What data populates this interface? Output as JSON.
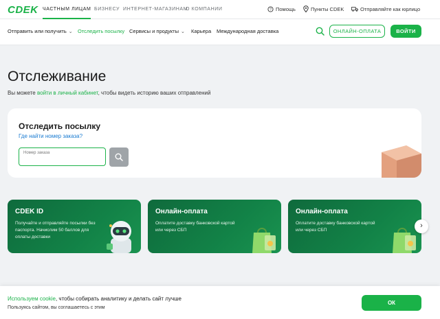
{
  "brand": {
    "logo": "CDEK",
    "accent": "#1ab248"
  },
  "top_segments": [
    "ЧАСТНЫМ ЛИЦАМ",
    "БИЗНЕСУ",
    "ИНТЕРНЕТ-МАГАЗИНАМ",
    "О КОМПАНИИ"
  ],
  "top_utils": {
    "help": "Помощь",
    "points": "Пункты CDEK",
    "send_as_company": "Отправляйте как юрлицо"
  },
  "nav": {
    "items": [
      "Отправить или получить",
      "Отследить посылку",
      "Сервисы и продукты",
      "Карьера",
      "Международная доставка"
    ],
    "online_payment": "ОНЛАЙН-ОПЛАТА",
    "login": "ВОЙТИ"
  },
  "main": {
    "title": "Отслеживание",
    "subtitle_before": "Вы можете ",
    "subtitle_link": "войти в личный кабинет",
    "subtitle_after": ", чтобы видеть историю ваших отправлений"
  },
  "tracking": {
    "title": "Отследить посылку",
    "help_link": "Где найти номер заказа?",
    "order_placeholder": "Номер заказа"
  },
  "promos": [
    {
      "title": "CDEK ID",
      "text": "Получайте и отправляйте посылки без паспорта. Начислим 50 баллов для оплаты доставки"
    },
    {
      "title": "Онлайн-оплата",
      "text": "Оплатите доставку банковской картой или через СБП"
    },
    {
      "title": "Онлайн-оплата",
      "text": "Оплатите доставку банковской картой или через СБП"
    }
  ],
  "cookie": {
    "green": "Используем cookie",
    "rest": ", чтобы собирать аналитику и делать сайт лучше",
    "line2": "Пользуясь сайтом, вы соглашаетесь с этим",
    "ok": "ОК"
  }
}
